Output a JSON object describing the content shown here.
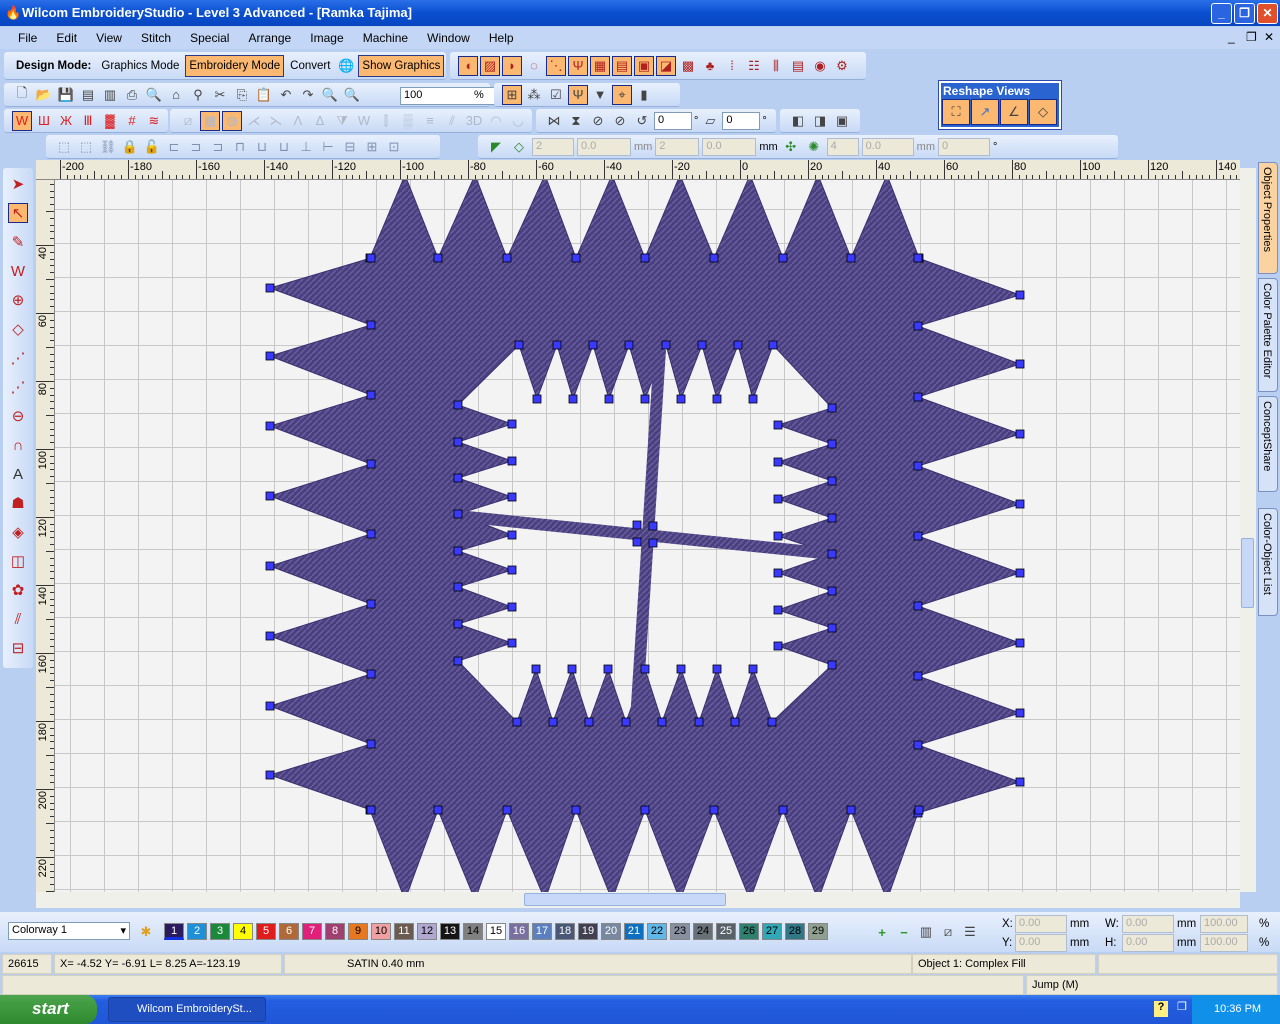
{
  "title": "Wilcom EmbroideryStudio - Level 3 Advanced - [Ramka          Tajima]",
  "window_buttons": [
    "_",
    "❐",
    "✕"
  ],
  "menu": [
    "File",
    "Edit",
    "View",
    "Stitch",
    "Special",
    "Arrange",
    "Image",
    "Machine",
    "Window",
    "Help"
  ],
  "mdi_buttons": [
    "_",
    "❐",
    "✕"
  ],
  "design_mode": {
    "label": "Design Mode:",
    "graphics": "Graphics Mode",
    "embroidery": "Embroidery Mode",
    "convert": "Convert",
    "show_graphics": "Show Graphics"
  },
  "toolbar_std": {
    "zoom_value": "100",
    "zoom_unit": "%"
  },
  "transform": {
    "rotate": "0",
    "skew": "0",
    "unit_deg": "°"
  },
  "stitch_params": {
    "v1": "2",
    "v2": "0.0",
    "unit1": "mm",
    "v3": "2",
    "v4": "0.0",
    "unit2": "mm",
    "v5": "4",
    "v6": "0.0",
    "unit3": "mm",
    "v7": "0",
    "unit4": "°"
  },
  "reshape_views": {
    "title": "Reshape Views"
  },
  "ruler_x": [
    "-200",
    "-180",
    "-160",
    "-140",
    "-120",
    "-100",
    "-80",
    "-60",
    "-40",
    "-20",
    "0",
    "20",
    "40",
    "60",
    "80",
    "100",
    "120",
    "140"
  ],
  "ruler_y": [
    "40",
    "60",
    "80",
    "100",
    "120",
    "140",
    "160",
    "180",
    "200",
    "220"
  ],
  "dock_tabs": [
    "Object Properties",
    "Color Palette Editor",
    "ConceptShare",
    "Color-Object List"
  ],
  "colorway": "Colorway 1",
  "palette": [
    {
      "n": "1",
      "c": "#2a1a5e",
      "t": "#fff"
    },
    {
      "n": "2",
      "c": "#1e90d8",
      "t": "#fff"
    },
    {
      "n": "3",
      "c": "#1a8a3a",
      "t": "#fff"
    },
    {
      "n": "4",
      "c": "#ffff00",
      "t": "#000"
    },
    {
      "n": "5",
      "c": "#e01c1c",
      "t": "#fff"
    },
    {
      "n": "6",
      "c": "#b06a3a",
      "t": "#fff"
    },
    {
      "n": "7",
      "c": "#e0207a",
      "t": "#fff"
    },
    {
      "n": "8",
      "c": "#a04070",
      "t": "#fff"
    },
    {
      "n": "9",
      "c": "#e87820",
      "t": "#000"
    },
    {
      "n": "10",
      "c": "#f0a0a0",
      "t": "#000"
    },
    {
      "n": "11",
      "c": "#6a5a50",
      "t": "#fff"
    },
    {
      "n": "12",
      "c": "#b0a8d0",
      "t": "#000"
    },
    {
      "n": "13",
      "c": "#151515",
      "t": "#fff"
    },
    {
      "n": "14",
      "c": "#808080",
      "t": "#000"
    },
    {
      "n": "15",
      "c": "#ffffff",
      "t": "#000"
    },
    {
      "n": "16",
      "c": "#7a70a0",
      "t": "#fff"
    },
    {
      "n": "17",
      "c": "#5a80c0",
      "t": "#fff"
    },
    {
      "n": "18",
      "c": "#4a5878",
      "t": "#fff"
    },
    {
      "n": "19",
      "c": "#404050",
      "t": "#fff"
    },
    {
      "n": "20",
      "c": "#7888a0",
      "t": "#fff"
    },
    {
      "n": "21",
      "c": "#1070c0",
      "t": "#fff"
    },
    {
      "n": "22",
      "c": "#60b8e8",
      "t": "#000"
    },
    {
      "n": "23",
      "c": "#8890a0",
      "t": "#000"
    },
    {
      "n": "24",
      "c": "#687078",
      "t": "#000"
    },
    {
      "n": "25",
      "c": "#586068",
      "t": "#fff"
    },
    {
      "n": "26",
      "c": "#308070",
      "t": "#000"
    },
    {
      "n": "27",
      "c": "#30a8b8",
      "t": "#000"
    },
    {
      "n": "28",
      "c": "#307888",
      "t": "#000"
    },
    {
      "n": "29",
      "c": "#90a090",
      "t": "#000"
    }
  ],
  "position": {
    "x_label": "X:",
    "y_label": "Y:",
    "w_label": "W:",
    "h_label": "H:",
    "x": "0.00",
    "y": "0.00",
    "w": "0.00",
    "h": "0.00",
    "wp": "100.00",
    "hp": "100.00",
    "mm": "mm",
    "pct": "%"
  },
  "status": {
    "stitch_count": "26615",
    "coords": "X=  -4.52 Y=  -6.91 L=   8.25 A=-123.19",
    "stitch_type": "SATIN  0.40 mm",
    "object": "Object 1: Complex Fill",
    "jump": "Jump (M)"
  },
  "taskbar": {
    "start": "start",
    "task": "Wilcom EmbroiderySt...",
    "time": "10:36 PM"
  },
  "colors": {
    "thread": "#4a4080",
    "accent": "#fbb870"
  }
}
